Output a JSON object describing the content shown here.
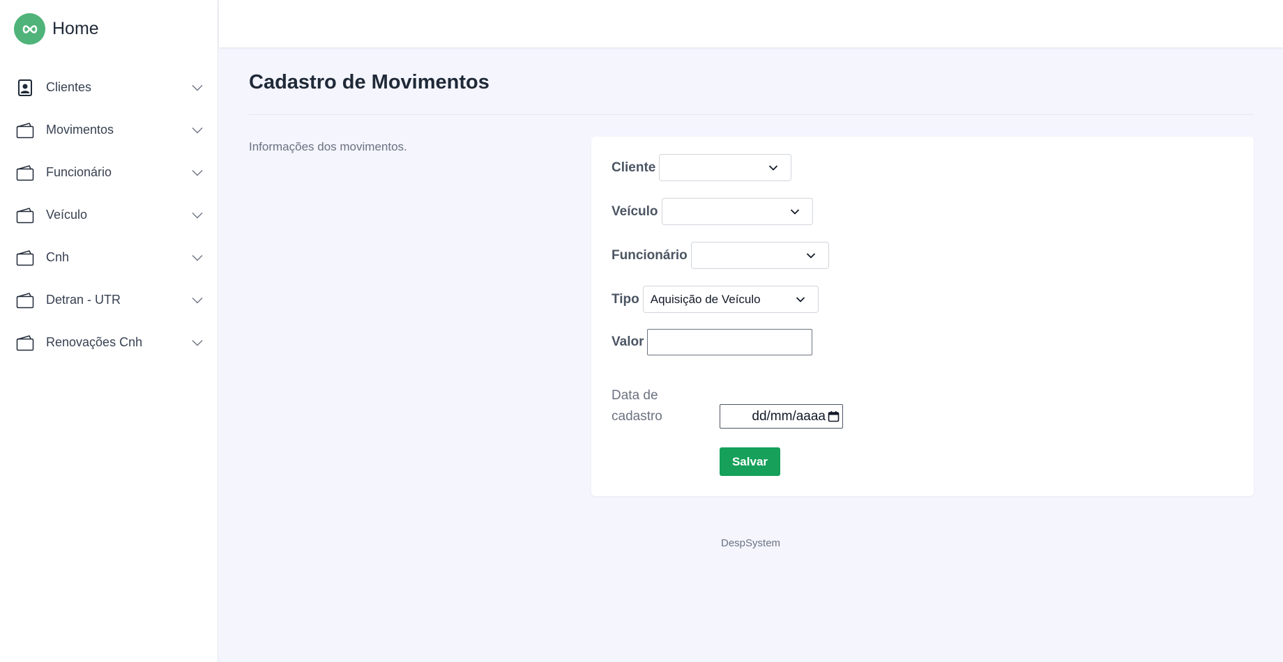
{
  "sidebar": {
    "brand": {
      "title": "Home",
      "icon": "infinity-icon"
    },
    "items": [
      {
        "label": "Clientes",
        "icon": "contact-card-icon"
      },
      {
        "label": "Movimentos",
        "icon": "wallet-icon"
      },
      {
        "label": "Funcionário",
        "icon": "wallet-icon"
      },
      {
        "label": "Veículo",
        "icon": "wallet-icon"
      },
      {
        "label": "Cnh",
        "icon": "wallet-icon"
      },
      {
        "label": "Detran - UTR",
        "icon": "wallet-icon"
      },
      {
        "label": "Renovações Cnh",
        "icon": "wallet-icon"
      }
    ]
  },
  "main": {
    "title": "Cadastro de Movimentos",
    "description": "Informações dos movimentos."
  },
  "form": {
    "cliente": {
      "label": "Cliente",
      "value": ""
    },
    "veiculo": {
      "label": "Veículo",
      "value": ""
    },
    "funcionario": {
      "label": "Funcionário",
      "value": ""
    },
    "tipo": {
      "label": "Tipo",
      "value": "Aquisição de Veículo"
    },
    "valor": {
      "label": "Valor",
      "value": ""
    },
    "data": {
      "label": "Data de cadastro",
      "placeholder": "dd/mm/aaaa"
    },
    "save_label": "Salvar"
  },
  "footer": {
    "text": "DespSystem"
  },
  "colors": {
    "brand": "#4fb37a",
    "primary_button": "#16a05a",
    "background": "#f4f5fd"
  }
}
